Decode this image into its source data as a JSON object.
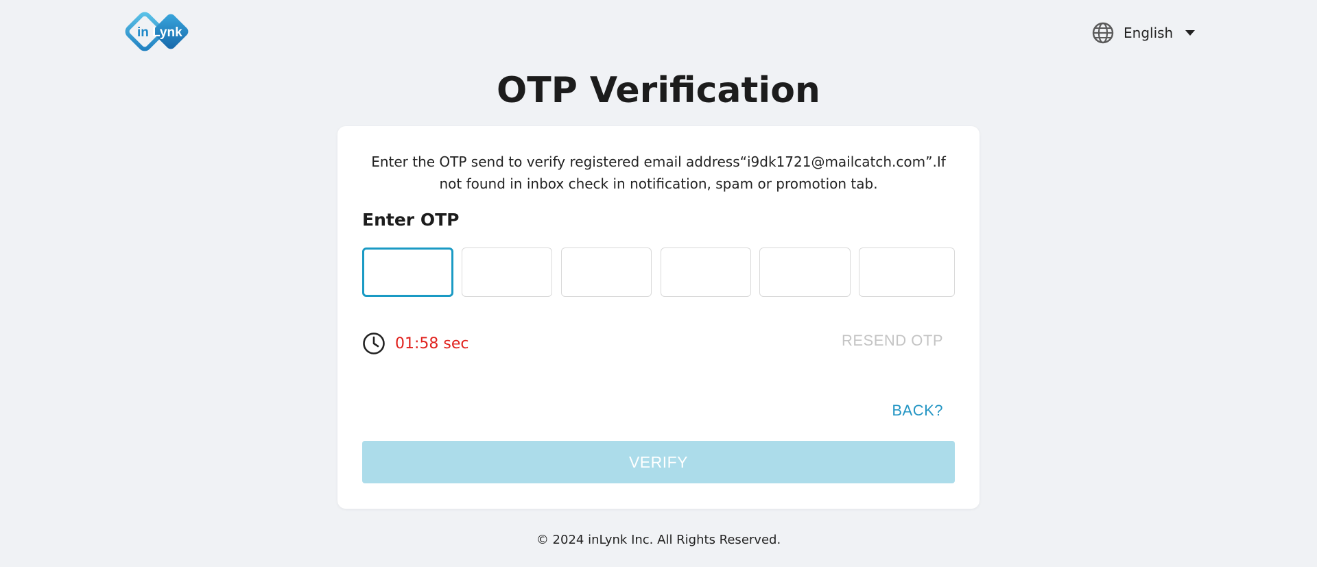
{
  "header": {
    "logo_text": "inLynk",
    "logo_icon": "inlynk-logo",
    "language": {
      "icon": "globe-icon",
      "selected": "English",
      "dropdown_icon": "caret-down-icon"
    }
  },
  "page": {
    "title": "OTP Verification"
  },
  "card": {
    "instructions": "Enter the OTP send to verify registered email address“i9dk1721@mailcatch.com”.If not found in inbox check in notification, spam or promotion tab.",
    "otp_label": "Enter OTP",
    "otp_digits": [
      "",
      "",
      "",
      "",
      "",
      ""
    ],
    "timer": {
      "icon": "clock-icon",
      "text": "01:58 sec"
    },
    "resend_label": "RESEND OTP",
    "back_label": "BACK?",
    "verify_label": "VERIFY"
  },
  "footer": {
    "copyright": "© 2024 inLynk Inc. All Rights Reserved."
  },
  "colors": {
    "background": "#f0f2f5",
    "accent": "#1a9ac4",
    "link": "#2596c4",
    "timer": "#e0201c",
    "verify_disabled": "#acdcea",
    "resend_disabled": "#c4c4c4"
  }
}
